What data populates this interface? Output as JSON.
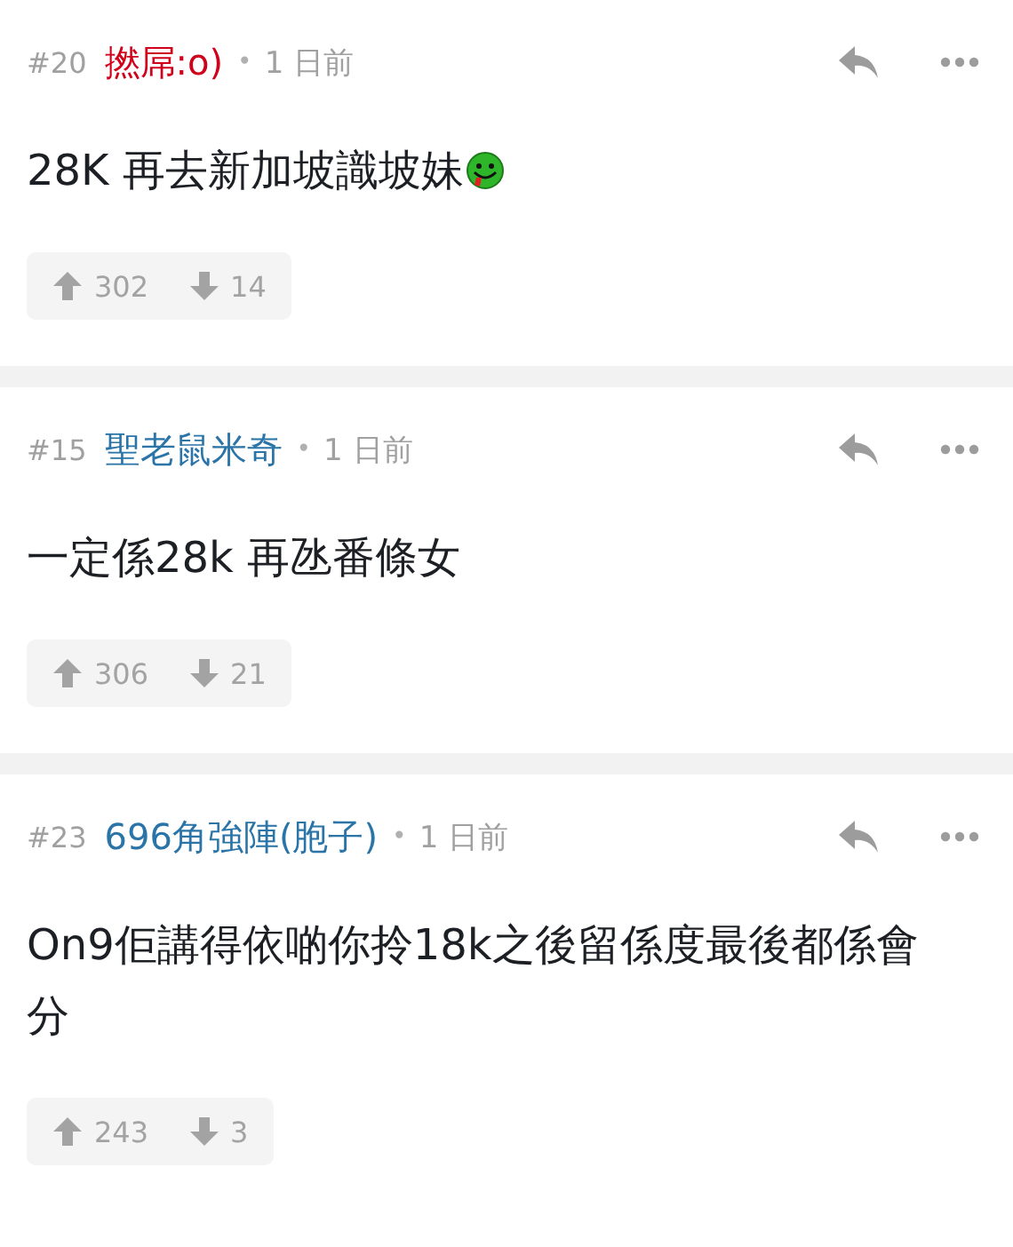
{
  "posts": [
    {
      "number": "#20",
      "author": "撚屌:o)",
      "color": "#d0021b",
      "separator": "•",
      "time": "1 日前",
      "body": "28K 再去新加坡識坡妹",
      "emoji": true,
      "upvotes": "302",
      "downvotes": "14"
    },
    {
      "number": "#15",
      "author": "聖老鼠米奇",
      "color": "#2a74a8",
      "separator": "•",
      "time": "1 日前",
      "body": "一定係28k 再氹番條女",
      "emoji": false,
      "upvotes": "306",
      "downvotes": "21"
    },
    {
      "number": "#23",
      "author": "696角強陣(胞子)",
      "color": "#2a74a8",
      "separator": "•",
      "time": "1 日前",
      "body": "On9佢講得依啲你拎18k之後留係度最後都係會分",
      "emoji": false,
      "upvotes": "243",
      "downvotes": "3"
    }
  ]
}
